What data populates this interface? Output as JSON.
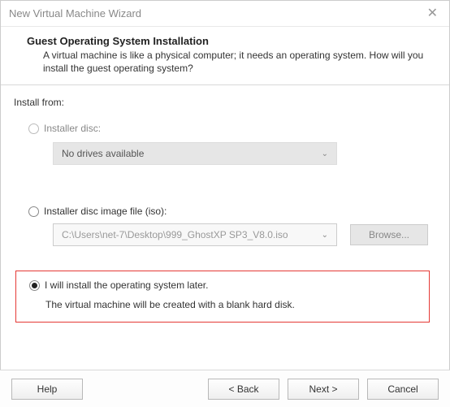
{
  "window": {
    "title": "New Virtual Machine Wizard"
  },
  "header": {
    "title": "Guest Operating System Installation",
    "desc": "A virtual machine is like a physical computer; it needs an operating system. How will you install the guest operating system?"
  },
  "body": {
    "install_from_label": "Install from:",
    "opt_disc_label": "Installer disc:",
    "disc_dropdown": "No drives available",
    "opt_iso_label": "Installer disc image file (iso):",
    "iso_path": "C:\\Users\\net-7\\Desktop\\999_GhostXP SP3_V8.0.iso",
    "browse_label": "Browse...",
    "opt_later_label": "I will install the operating system later.",
    "later_note": "The virtual machine will be created with a blank hard disk."
  },
  "footer": {
    "help": "Help",
    "back": "< Back",
    "next": "Next >",
    "cancel": "Cancel"
  }
}
